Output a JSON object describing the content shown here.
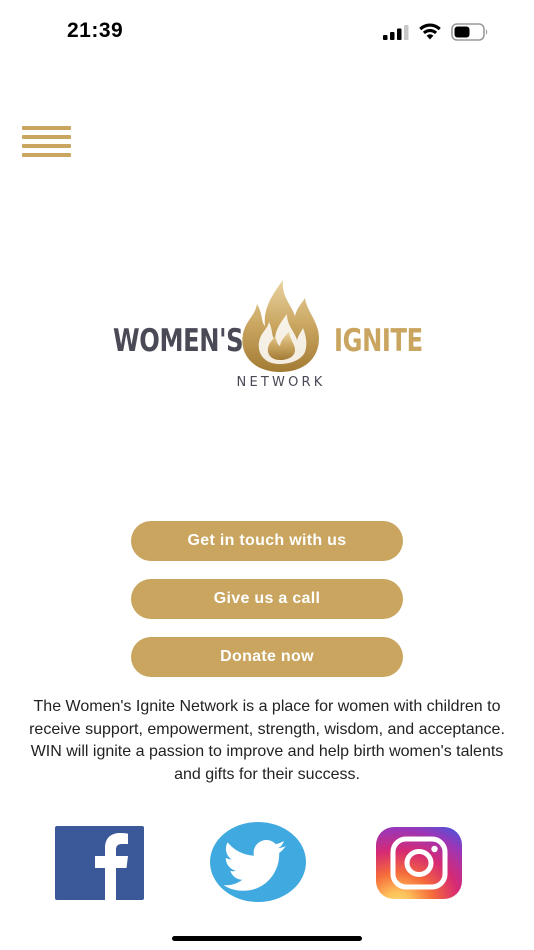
{
  "status_bar": {
    "time": "21:39"
  },
  "icons": {
    "signal": "cellular-signal-icon",
    "wifi": "wifi-icon",
    "battery": "battery-icon",
    "menu": "hamburger-menu-icon",
    "flame": "flame-icon",
    "facebook": "facebook-icon",
    "twitter": "twitter-icon",
    "instagram": "instagram-icon"
  },
  "colors": {
    "accent_gold": "#c9a55f",
    "logo_gray": "#4a4a57",
    "facebook_blue": "#3b5998",
    "twitter_blue": "#3fa9e0"
  },
  "logo": {
    "word_left": "WOMEN'S",
    "word_right": "IGNITE",
    "subtitle": "NETWORK"
  },
  "actions": {
    "contact_label": "Get in touch with us",
    "call_label": "Give us a call",
    "donate_label": "Donate now"
  },
  "description": "The Women's Ignite Network is a place for women with children to receive support, empowerment, strength, wisdom, and acceptance. WIN will ignite a passion to improve and help birth women's talents and gifts for their success."
}
